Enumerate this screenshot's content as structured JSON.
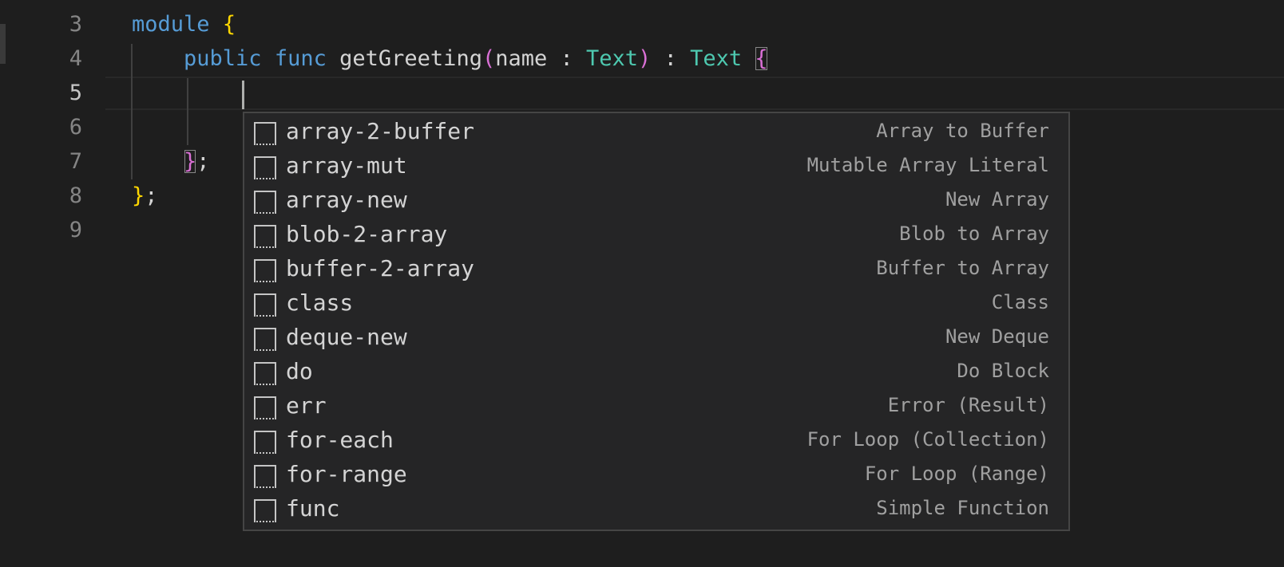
{
  "editor": {
    "lines": [
      {
        "number": "3"
      },
      {
        "number": "4"
      },
      {
        "number": "5"
      },
      {
        "number": "6"
      },
      {
        "number": "7"
      },
      {
        "number": "8"
      },
      {
        "number": "9"
      }
    ],
    "code": {
      "line3_keyword": "module",
      "line3_brace": "{",
      "line4_public": "public",
      "line4_func": "func",
      "line4_name": "getGreeting",
      "line4_open_paren": "(",
      "line4_param": "name : ",
      "line4_param_type": "Text",
      "line4_close_paren": ")",
      "line4_colon": " : ",
      "line4_return_type": "Text",
      "line4_open_brace": "{",
      "line7_close_brace": "}",
      "line7_semicolon": ";",
      "line8_close_brace": "}",
      "line8_semicolon": ";"
    }
  },
  "suggestions": [
    {
      "label": "array-2-buffer",
      "detail": "Array to Buffer",
      "icon": "snippet-icon"
    },
    {
      "label": "array-mut",
      "detail": "Mutable Array Literal",
      "icon": "snippet-icon"
    },
    {
      "label": "array-new",
      "detail": "New Array",
      "icon": "snippet-icon"
    },
    {
      "label": "blob-2-array",
      "detail": "Blob to Array",
      "icon": "snippet-icon"
    },
    {
      "label": "buffer-2-array",
      "detail": "Buffer to Array",
      "icon": "snippet-icon"
    },
    {
      "label": "class",
      "detail": "Class",
      "icon": "snippet-icon"
    },
    {
      "label": "deque-new",
      "detail": "New Deque",
      "icon": "snippet-icon"
    },
    {
      "label": "do",
      "detail": "Do Block",
      "icon": "snippet-icon"
    },
    {
      "label": "err",
      "detail": "Error (Result)",
      "icon": "snippet-icon"
    },
    {
      "label": "for-each",
      "detail": "For Loop (Collection)",
      "icon": "snippet-icon"
    },
    {
      "label": "for-range",
      "detail": "For Loop (Range)",
      "icon": "snippet-icon"
    },
    {
      "label": "func",
      "detail": "Simple Function",
      "icon": "snippet-icon"
    }
  ],
  "colors": {
    "background": "#1e1e1e",
    "keyword": "#569cd6",
    "type": "#4ec9b0",
    "bracket_level1": "#ffd700",
    "bracket_level2": "#da70d6",
    "widget_background": "#252526"
  }
}
